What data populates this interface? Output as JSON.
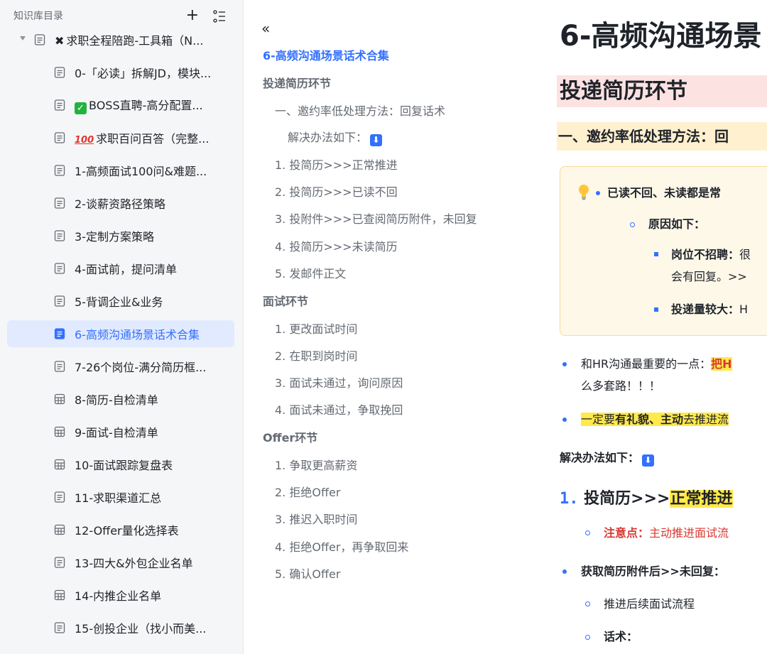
{
  "sidebar": {
    "title": "知识库目录",
    "add_icon": "plus-icon",
    "list_icon": "list-settings-icon",
    "items": [
      {
        "label": "求职全程陪跑-工具箱（N...",
        "icon": "doc-icon",
        "emoji": "🛠",
        "expanded": true,
        "level": 0
      },
      {
        "label": "0-「必读」拆解JD，模块...",
        "icon": "doc-icon",
        "level": 1
      },
      {
        "label": "BOSS直聘-高分配置...",
        "icon": "doc-icon",
        "emoji": "✓",
        "level": 1
      },
      {
        "label": "求职百问百答（完整...",
        "icon": "doc-icon",
        "emoji": "💯",
        "level": 1
      },
      {
        "label": "1-高频面试100问&难题...",
        "icon": "doc-icon",
        "level": 1
      },
      {
        "label": "2-谈薪资路径策略",
        "icon": "doc-icon",
        "level": 1
      },
      {
        "label": "3-定制方案策略",
        "icon": "doc-icon",
        "level": 1
      },
      {
        "label": "4-面试前，提问清单",
        "icon": "doc-icon",
        "level": 1
      },
      {
        "label": "5-背调企业&业务",
        "icon": "doc-icon",
        "level": 1
      },
      {
        "label": "6-高频沟通场景话术合集",
        "icon": "doc-icon",
        "level": 1,
        "active": true
      },
      {
        "label": "7-26个岗位-满分简历框...",
        "icon": "doc-icon",
        "level": 1
      },
      {
        "label": "8-简历-自检清单",
        "icon": "sheet-icon",
        "level": 1
      },
      {
        "label": "9-面试-自检清单",
        "icon": "sheet-icon",
        "level": 1
      },
      {
        "label": "10-面试跟踪复盘表",
        "icon": "sheet-icon",
        "level": 1
      },
      {
        "label": "11-求职渠道汇总",
        "icon": "doc-icon",
        "level": 1
      },
      {
        "label": "12-Offer量化选择表",
        "icon": "sheet-icon",
        "level": 1
      },
      {
        "label": "13-四大&外包企业名单",
        "icon": "doc-icon",
        "level": 1
      },
      {
        "label": "14-内推企业名单",
        "icon": "sheet-icon",
        "level": 1
      },
      {
        "label": "15-创投企业（找小而美...",
        "icon": "doc-icon",
        "level": 1
      }
    ]
  },
  "outline": {
    "collapse_icon": "double-chevron-left-icon",
    "items": [
      {
        "text": "6-高频沟通场景话术合集",
        "level": 1
      },
      {
        "text": "投递简历环节",
        "level": 2
      },
      {
        "text": "一、邀约率低处理方法：回复话术",
        "level": 3
      },
      {
        "text": "解决办法如下：",
        "level": 4,
        "badge": "⬇"
      },
      {
        "text": "1. 投简历>>>正常推进",
        "level": 3
      },
      {
        "text": "2. 投简历>>>已读不回",
        "level": 3
      },
      {
        "text": "3. 投附件>>>已查阅简历附件，未回复",
        "level": 3
      },
      {
        "text": "4. 投简历>>>未读简历",
        "level": 3
      },
      {
        "text": "5. 发邮件正文",
        "level": 3
      },
      {
        "text": "面试环节",
        "level": 2
      },
      {
        "text": "1. 更改面试时间",
        "level": 3
      },
      {
        "text": "2. 在职到岗时间",
        "level": 3
      },
      {
        "text": "3. 面试未通过，询问原因",
        "level": 3
      },
      {
        "text": "4. 面试未通过，争取挽回",
        "level": 3
      },
      {
        "text": "Offer环节",
        "level": 2
      },
      {
        "text": "1. 争取更高薪资",
        "level": 3
      },
      {
        "text": "2. 拒绝Offer",
        "level": 3
      },
      {
        "text": "3. 推迟入职时间",
        "level": 3
      },
      {
        "text": "4. 拒绝Offer，再争取回来",
        "level": 3
      },
      {
        "text": "5. 确认Offer",
        "level": 3
      }
    ]
  },
  "content": {
    "title": "6-高频沟通场景",
    "section_heading": "投递简历环节",
    "sub_heading": "一、邀约率低处理方法：回",
    "callout": {
      "icon": "lightbulb-icon",
      "bullet1": "已读不回、未读都是常",
      "reason_label": "原因如下：",
      "item1_bold": "岗位不招聘：",
      "item1_rest": "很",
      "item1_line2": "会有回复。>>",
      "item2_bold": "投递量较大：",
      "item2_rest": "H"
    },
    "bullet_a_pre": "和HR沟通最重要的一点：",
    "bullet_a_red": "把H",
    "bullet_a_line2": "么多套路！！！",
    "bullet_b_hl1": "一定要",
    "bullet_b_bold": "有礼貌、主动",
    "bullet_b_rest": "去推进流",
    "solution_label": "解决办法如下：",
    "solution_badge": "⬇",
    "num_item_num": "1.",
    "num_item_pre": "投简历>>>",
    "num_item_hl": "正常推进",
    "note_label": "注意点：",
    "note_text": "主动推进面试流",
    "bullet_c": "获取简历附件后>>未回复：",
    "sub_c1": "推进后续面试流程",
    "sub_c2": "话术："
  }
}
